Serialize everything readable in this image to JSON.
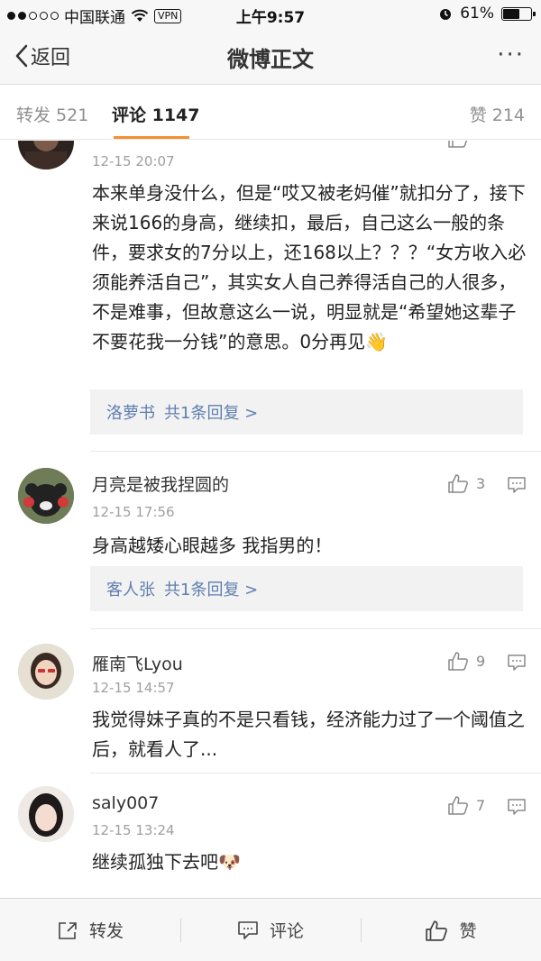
{
  "status_bar": {
    "carrier": "中国联通",
    "vpn": "VPN",
    "time": "上午9:57",
    "battery": "61%",
    "battery_level": 0.61
  },
  "nav": {
    "back_label": "返回",
    "title": "微博正文",
    "more_label": "···"
  },
  "tabs": {
    "repost": "转发 521",
    "comment": "评论 1147",
    "like": "赞 214"
  },
  "comments": [
    {
      "user": "",
      "time": "12-15 20:07",
      "text": "本来单身没什么，但是“哎又被老妈催”就扣分了，接下来说166的身高，继续扣，最后，自己这么一般的条件，要求女的7分以上，还168以上？？？“女方收入必须能养活自己”，其实女人自己养得活自己的人很多，不是难事，但故意这么一说，明显就是“希望她这辈子不要花我一分钱”的意思。0分再见👋",
      "reply_user": "洛萝书",
      "reply_count": "共1条回复 >",
      "likes": ""
    },
    {
      "user": "月亮是被我捏圆的",
      "time": "12-15 17:56",
      "text": "身高越矮心眼越多 我指男的！",
      "reply_user": "客人张",
      "reply_count": "共1条回复 >",
      "likes": "3"
    },
    {
      "user": "雁南飞Lyou",
      "time": "12-15 14:57",
      "text": "我觉得妹子真的不是只看钱，经济能力过了一个阈值之后，就看人了...",
      "likes": "9"
    },
    {
      "user": "saly007",
      "time": "12-15 13:24",
      "text": "继续孤独下去吧🐶",
      "likes": "7"
    }
  ],
  "bottom_bar": {
    "repost": "转发",
    "comment": "评论",
    "like": "赞"
  },
  "colors": {
    "accent": "#f58f2e",
    "link": "#5f7fb0"
  }
}
